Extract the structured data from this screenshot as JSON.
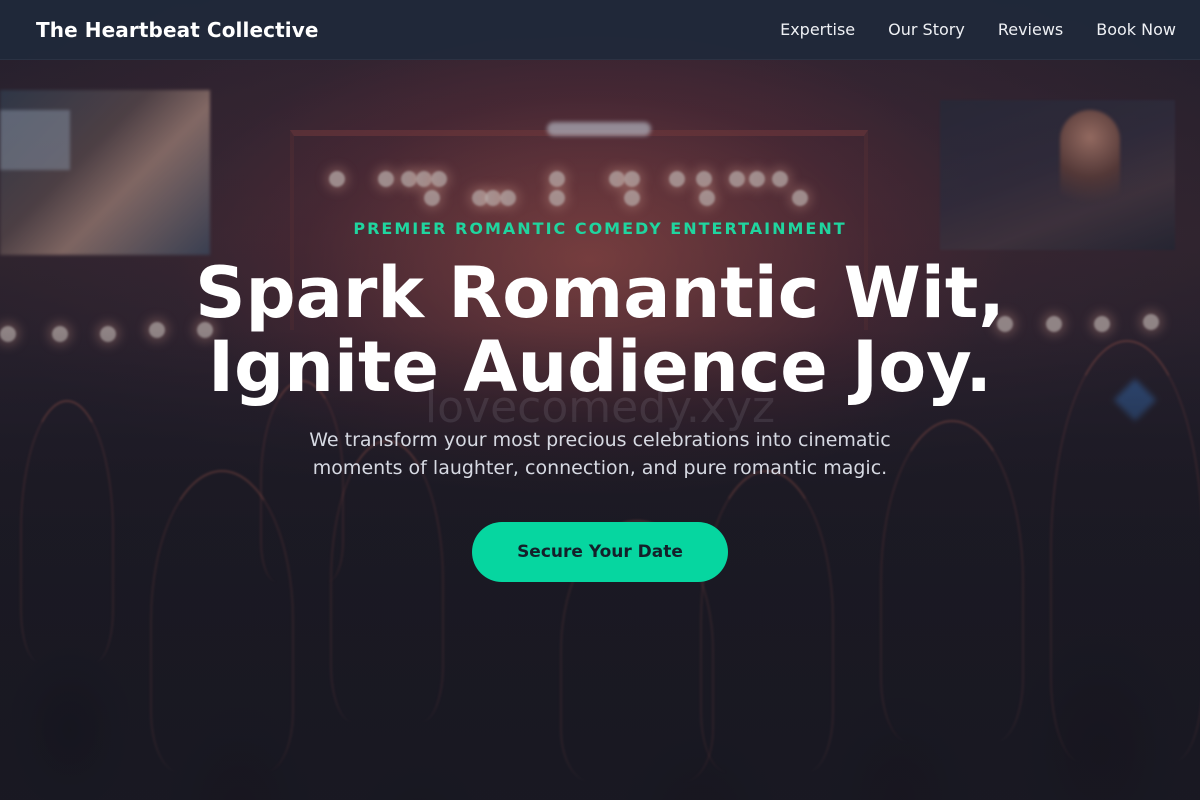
{
  "navbar": {
    "brand": "The Heartbeat Collective",
    "links": [
      {
        "label": "Expertise"
      },
      {
        "label": "Our Story"
      },
      {
        "label": "Reviews"
      },
      {
        "label": "Book Now"
      }
    ]
  },
  "hero": {
    "eyebrow": "PREMIER ROMANTIC COMEDY ENTERTAINMENT",
    "headline_line1": "Spark Romantic Wit,",
    "headline_line2": "Ignite Audience Joy.",
    "watermark": "lovecomedy.xyz",
    "subtitle": "We transform your most precious celebrations into cinematic moments of laughter, connection, and pure romantic magic.",
    "cta_label": "Secure Your Date"
  },
  "colors": {
    "accent": "#06d6a0",
    "eyebrow": "#20d59f",
    "navbar_bg": "#1f293a"
  }
}
